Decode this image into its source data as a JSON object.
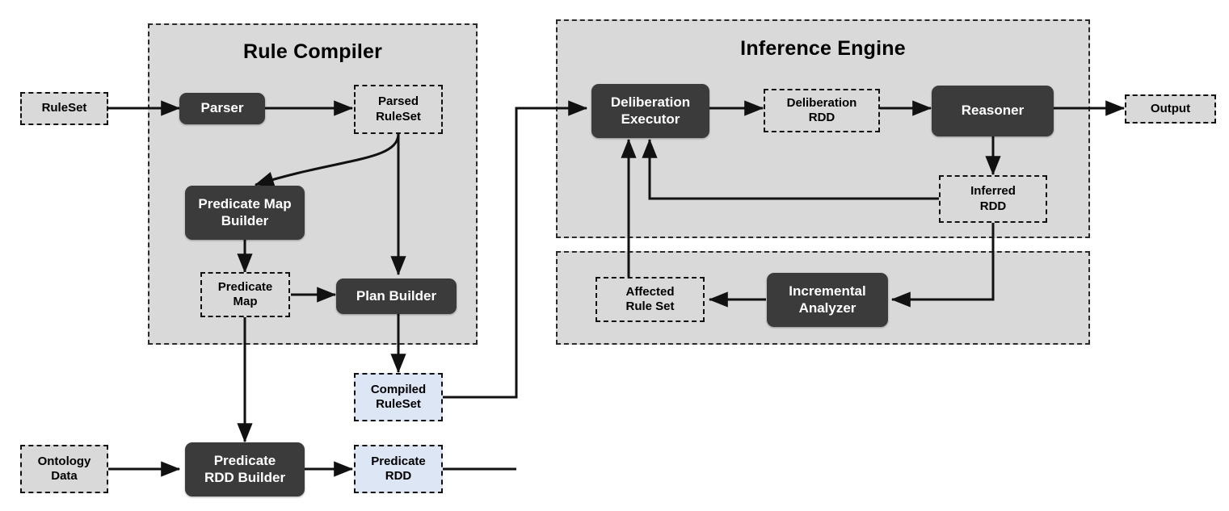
{
  "diagram": {
    "title": "Rule Compiler / Inference Engine architecture",
    "colors": {
      "process_fill": "#3b3b3b",
      "data_fill": "#d9d9d9",
      "rdd_fill": "#dce6f5",
      "group_fill": "#d9d9d9",
      "stroke": "#111111",
      "canvas": "#ffffff"
    }
  },
  "groups": [
    {
      "id": "rule-compiler",
      "title": "Rule Compiler"
    },
    {
      "id": "inference-engine",
      "title": "Inference Engine"
    },
    {
      "id": "incremental-group",
      "title": ""
    }
  ],
  "nodes": {
    "ruleset": "RuleSet",
    "parser": "Parser",
    "parsed_ruleset": "Parsed\nRuleSet",
    "predicate_map_builder": "Predicate Map\nBuilder",
    "predicate_map": "Predicate\nMap",
    "plan_builder": "Plan Builder",
    "compiled_ruleset": "Compiled\nRuleSet",
    "ontology_data": "Ontology\nData",
    "predicate_rdd_builder": "Predicate\nRDD Builder",
    "predicate_rdd": "Predicate\nRDD",
    "deliberation_executor": "Deliberation\nExecutor",
    "deliberation_rdd": "Deliberation\nRDD",
    "reasoner": "Reasoner",
    "output": "Output",
    "inferred_rdd": "Inferred\nRDD",
    "incremental_analyzer": "Incremental\nAnalyzer",
    "affected_rule_set": "Affected\nRule Set"
  },
  "edges": [
    {
      "from": "ruleset",
      "to": "parser"
    },
    {
      "from": "parser",
      "to": "parsed_ruleset"
    },
    {
      "from": "parsed_ruleset",
      "to": "predicate_map_builder"
    },
    {
      "from": "parsed_ruleset",
      "to": "plan_builder"
    },
    {
      "from": "predicate_map_builder",
      "to": "predicate_map"
    },
    {
      "from": "predicate_map",
      "to": "plan_builder"
    },
    {
      "from": "predicate_map",
      "to": "predicate_rdd_builder"
    },
    {
      "from": "plan_builder",
      "to": "compiled_ruleset"
    },
    {
      "from": "ontology_data",
      "to": "predicate_rdd_builder"
    },
    {
      "from": "predicate_rdd_builder",
      "to": "predicate_rdd"
    },
    {
      "from": "compiled_ruleset",
      "to": "deliberation_executor"
    },
    {
      "from": "predicate_rdd",
      "to": "deliberation_executor"
    },
    {
      "from": "deliberation_executor",
      "to": "deliberation_rdd"
    },
    {
      "from": "deliberation_rdd",
      "to": "reasoner"
    },
    {
      "from": "reasoner",
      "to": "output"
    },
    {
      "from": "reasoner",
      "to": "inferred_rdd"
    },
    {
      "from": "inferred_rdd",
      "to": "deliberation_executor"
    },
    {
      "from": "inferred_rdd",
      "to": "incremental_analyzer"
    },
    {
      "from": "incremental_analyzer",
      "to": "affected_rule_set"
    },
    {
      "from": "affected_rule_set",
      "to": "deliberation_executor"
    }
  ]
}
